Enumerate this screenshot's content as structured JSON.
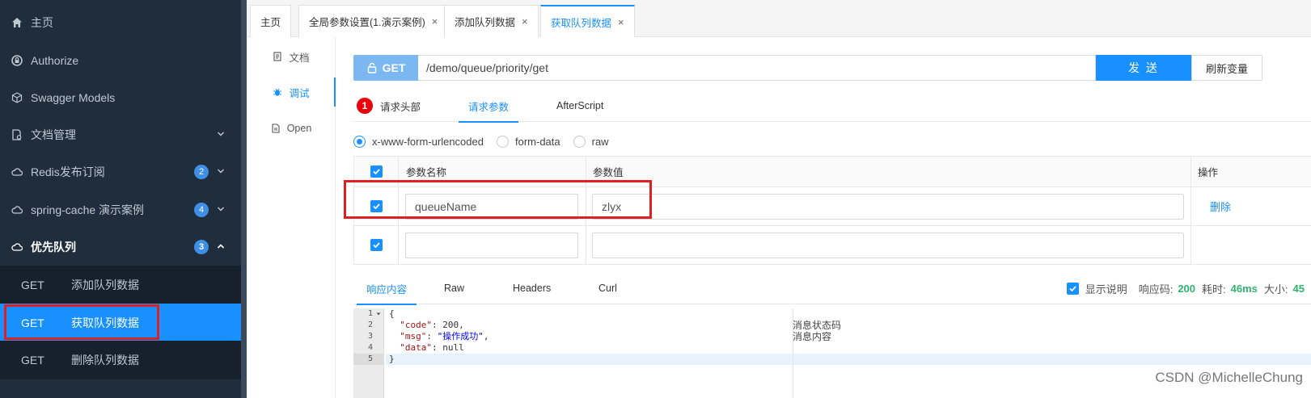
{
  "sidebar": {
    "items": [
      {
        "label": "主页",
        "icon": "home-icon"
      },
      {
        "label": "Authorize",
        "icon": "lock-icon"
      },
      {
        "label": "Swagger Models",
        "icon": "cube-icon"
      },
      {
        "label": "文档管理",
        "icon": "doc-manage-icon"
      },
      {
        "label": "Redis发布订阅",
        "icon": "cloud-icon",
        "badge": "2"
      },
      {
        "label": "spring-cache 演示案例",
        "icon": "cloud-icon",
        "badge": "4"
      },
      {
        "label": "优先队列",
        "icon": "cloud-icon",
        "badge": "3"
      }
    ],
    "subitems": [
      {
        "method": "GET",
        "label": "添加队列数据"
      },
      {
        "method": "GET",
        "label": "获取队列数据"
      },
      {
        "method": "GET",
        "label": "删除队列数据"
      }
    ]
  },
  "tabs": [
    {
      "label": "主页"
    },
    {
      "label": "全局参数设置(1.演示案例)",
      "close": "×"
    },
    {
      "label": "添加队列数据",
      "close": "×"
    },
    {
      "label": "获取队列数据",
      "close": "×"
    }
  ],
  "vmenu": [
    {
      "label": "文档"
    },
    {
      "label": "调试"
    },
    {
      "label": "Open"
    }
  ],
  "request": {
    "method": "GET",
    "url": "/demo/queue/priority/get",
    "send_label": "发 送",
    "refresh_label": "刷新变量"
  },
  "req_tabs": {
    "header_badge": "1",
    "header": "请求头部",
    "params": "请求参数",
    "after": "AfterScript"
  },
  "body_types": [
    "x-www-form-urlencoded",
    "form-data",
    "raw"
  ],
  "param_table": {
    "col_name": "参数名称",
    "col_value": "参数值",
    "col_ops": "操作",
    "rows": [
      {
        "name": "queueName",
        "value": "zlyx",
        "op": "删除"
      },
      {
        "name": "",
        "value": "",
        "op": ""
      }
    ]
  },
  "resp_tabs": {
    "content": "响应内容",
    "raw": "Raw",
    "headers": "Headers",
    "curl": "Curl"
  },
  "resp_info": {
    "show_desc": "显示说明",
    "code_label": "响应码:",
    "code": "200",
    "time_label": "耗时:",
    "time": "46ms",
    "size_label": "大小:",
    "size": "45"
  },
  "code": {
    "lines": [
      "1",
      "2",
      "3",
      "4",
      "5"
    ],
    "open": "{",
    "k_code": "\"code\"",
    "v_code": " 200,",
    "k_msg": "\"msg\"",
    "v_msg": "\"操作成功\"",
    "k_data": "\"data\"",
    "v_data": " null",
    "close": "}",
    "c_code": "消息状态码",
    "c_msg": "消息内容"
  },
  "watermark": "CSDN @MichelleChung",
  "colors": {
    "primary": "#1890ff",
    "sidebar": "#1f2d3d",
    "highlight": "#e02020",
    "success": "#2fb36e"
  }
}
